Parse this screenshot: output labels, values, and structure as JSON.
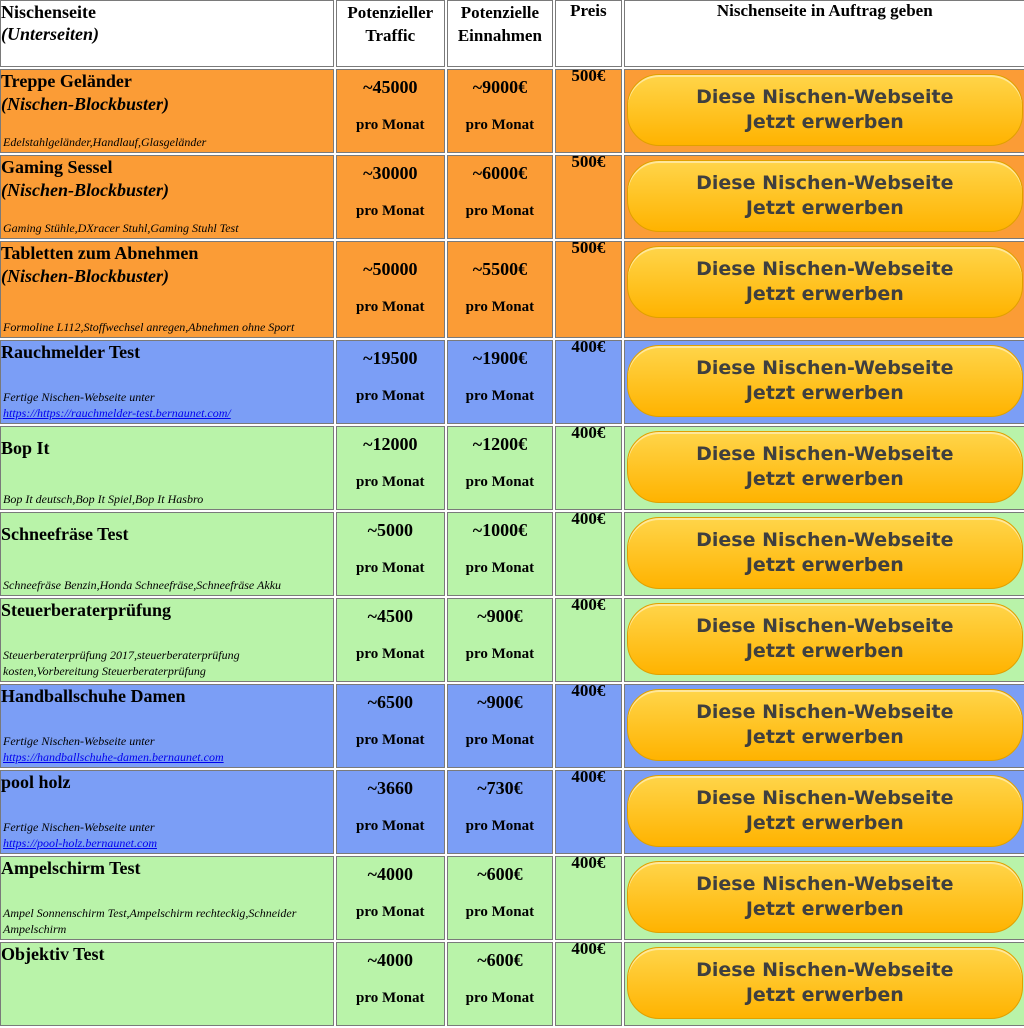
{
  "header": {
    "col1_title": "Nischenseite",
    "col1_sub": "(Unterseiten)",
    "col2_line1": "Potenzieller",
    "col2_line2": "Traffic",
    "col3_line1": "Potenzielle",
    "col3_line2": "Einnahmen",
    "col4": "Preis",
    "col5": "Nischenseite in Auftrag geben"
  },
  "button": {
    "line1": "Diese Nischen-Webseite",
    "line2": "Jetzt erwerben"
  },
  "per_month": "pro Monat",
  "rows": [
    {
      "title": "Treppe Geländer",
      "tag": "(Nischen-Blockbuster)",
      "keywords": "Edelstahlgeländer,Handlauf,Glasgeländer",
      "traffic": "~45000",
      "income": "~9000€",
      "price": "500€"
    },
    {
      "title": "Gaming Sessel",
      "tag": "(Nischen-Blockbuster)",
      "keywords": "Gaming Stühle,DXracer Stuhl,Gaming Stuhl Test",
      "traffic": "~30000",
      "income": "~6000€",
      "price": "500€"
    },
    {
      "title": "Tabletten zum Abnehmen",
      "tag": "(Nischen-Blockbuster)",
      "keywords": "Formoline L112,Stoffwechsel anregen,Abnehmen ohne Sport",
      "traffic": "~50000",
      "income": "~5500€",
      "price": "500€"
    },
    {
      "title": "Rauchmelder Test",
      "keywords": "Fertige Nischen-Webseite unter",
      "link": "https://https://rauchmelder-test.bernaunet.com/",
      "traffic": "~19500",
      "income": "~1900€",
      "price": "400€"
    },
    {
      "title": "Bop It",
      "keywords": "Bop It deutsch,Bop It Spiel,Bop It Hasbro",
      "traffic": "~12000",
      "income": "~1200€",
      "price": "400€"
    },
    {
      "title": "Schneefräse Test",
      "keywords": "Schneefräse Benzin,Honda Schneefräse,Schneefräse Akku",
      "traffic": "~5000",
      "income": "~1000€",
      "price": "400€"
    },
    {
      "title": "Steuerberaterprüfung",
      "keywords": "Steuerberaterprüfung 2017,steuerberaterprüfung kosten,Vorbereitung Steuerberaterprüfung",
      "traffic": "~4500",
      "income": "~900€",
      "price": "400€"
    },
    {
      "title": "Handballschuhe Damen",
      "keywords": "Fertige Nischen-Webseite unter",
      "link": "https://handballschuhe-damen.bernaunet.com",
      "traffic": "~6500",
      "income": "~900€",
      "price": "400€"
    },
    {
      "title": "pool holz",
      "keywords": "Fertige Nischen-Webseite unter",
      "link": "https://pool-holz.bernaunet.com",
      "traffic": "~3660",
      "income": "~730€",
      "price": "400€"
    },
    {
      "title": "Ampelschirm Test",
      "keywords": "Ampel Sonnenschirm Test,Ampelschirm rechteckig,Schneider Ampelschirm",
      "traffic": "~4000",
      "income": "~600€",
      "price": "400€"
    },
    {
      "title": "Objektiv Test",
      "keywords": "",
      "traffic": "~4000",
      "income": "~600€",
      "price": "400€"
    }
  ],
  "colors": {
    "orange": "#fb9c36",
    "blue": "#7b9ef6",
    "green": "#b9f3a9",
    "button": "#ffc21f"
  }
}
